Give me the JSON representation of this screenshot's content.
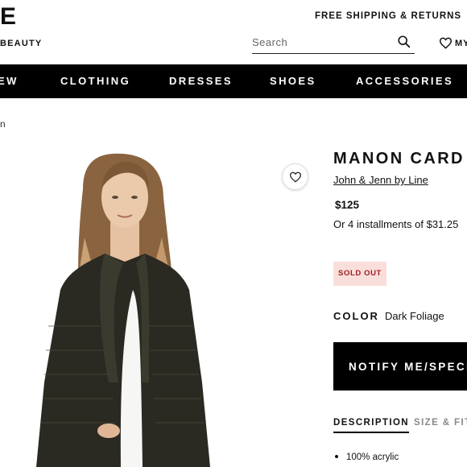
{
  "header": {
    "logo_text": "E",
    "sub_brand": "BEAUTY",
    "shipping_text": "FREE SHIPPING & RETURNS",
    "search_placeholder": "Search",
    "account_label": "MY"
  },
  "nav": {
    "items": [
      {
        "label": "EW"
      },
      {
        "label": "CLOTHING"
      },
      {
        "label": "DRESSES"
      },
      {
        "label": "SHOES"
      },
      {
        "label": "ACCESSORIES"
      }
    ]
  },
  "breadcrumb": {
    "text": "n"
  },
  "product": {
    "name": "MANON CARD",
    "brand": "John & Jenn by Line",
    "price": "$125",
    "installments": "Or 4 installments of $31.25",
    "stock_badge": "SOLD OUT",
    "color_label": "COLOR",
    "color_value": "Dark Foliage",
    "notify_button": "NOTIFY ME/SPECIA",
    "tabs": [
      {
        "label": "DESCRIPTION",
        "active": true
      },
      {
        "label": "SIZE & FIT",
        "active": false
      }
    ],
    "details": [
      "100% acrylic"
    ]
  },
  "colors": {
    "nav_bg": "#000000",
    "sold_out_bg": "#f9dedc",
    "sold_out_text": "#9b1b1b",
    "cardigan": "#2b2a22"
  },
  "icons": {
    "search": "search-icon",
    "account": "heart-icon",
    "favorite": "heart-icon"
  }
}
